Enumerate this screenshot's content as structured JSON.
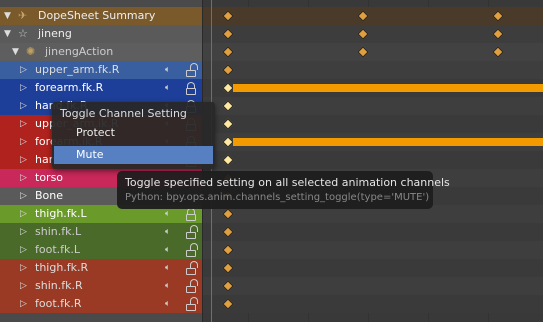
{
  "channels": [
    {
      "label": "DopeSheet Summary",
      "type": "summary"
    },
    {
      "label": "jineng",
      "type": "object"
    },
    {
      "label": "jinengAction",
      "type": "action"
    },
    {
      "label": "upper_arm.fk.R",
      "type": "group"
    },
    {
      "label": "forearm.fk.R",
      "type": "group"
    },
    {
      "label": "hand.fk.R",
      "type": "group"
    },
    {
      "label": "upper_arm.ik.R",
      "type": "group"
    },
    {
      "label": "forearm.ik.R",
      "type": "group"
    },
    {
      "label": "hand.ik.R",
      "type": "group"
    },
    {
      "label": "torso",
      "type": "group"
    },
    {
      "label": "Bone",
      "type": "group"
    },
    {
      "label": "thigh.fk.L",
      "type": "group"
    },
    {
      "label": "shin.fk.L",
      "type": "group"
    },
    {
      "label": "foot.fk.L",
      "type": "group"
    },
    {
      "label": "thigh.fk.R",
      "type": "group"
    },
    {
      "label": "shin.fk.R",
      "type": "group"
    },
    {
      "label": "foot.fk.R",
      "type": "group"
    }
  ],
  "menu": {
    "title": "Toggle Channel Setting",
    "items": [
      "Protect",
      "Mute"
    ],
    "active_item": "Mute"
  },
  "tooltip": {
    "description": "Toggle specified setting on all selected animation channels",
    "python": "Python: bpy.ops.anim.channels_setting_toggle(type='MUTE')"
  },
  "colors": {
    "keyframe": "#e0a040",
    "keyframe_selected": "#ffe9a0",
    "hold_bar": "#f29a00",
    "menu_highlight": "#5680c2",
    "playhead": "#4f8a3c"
  }
}
